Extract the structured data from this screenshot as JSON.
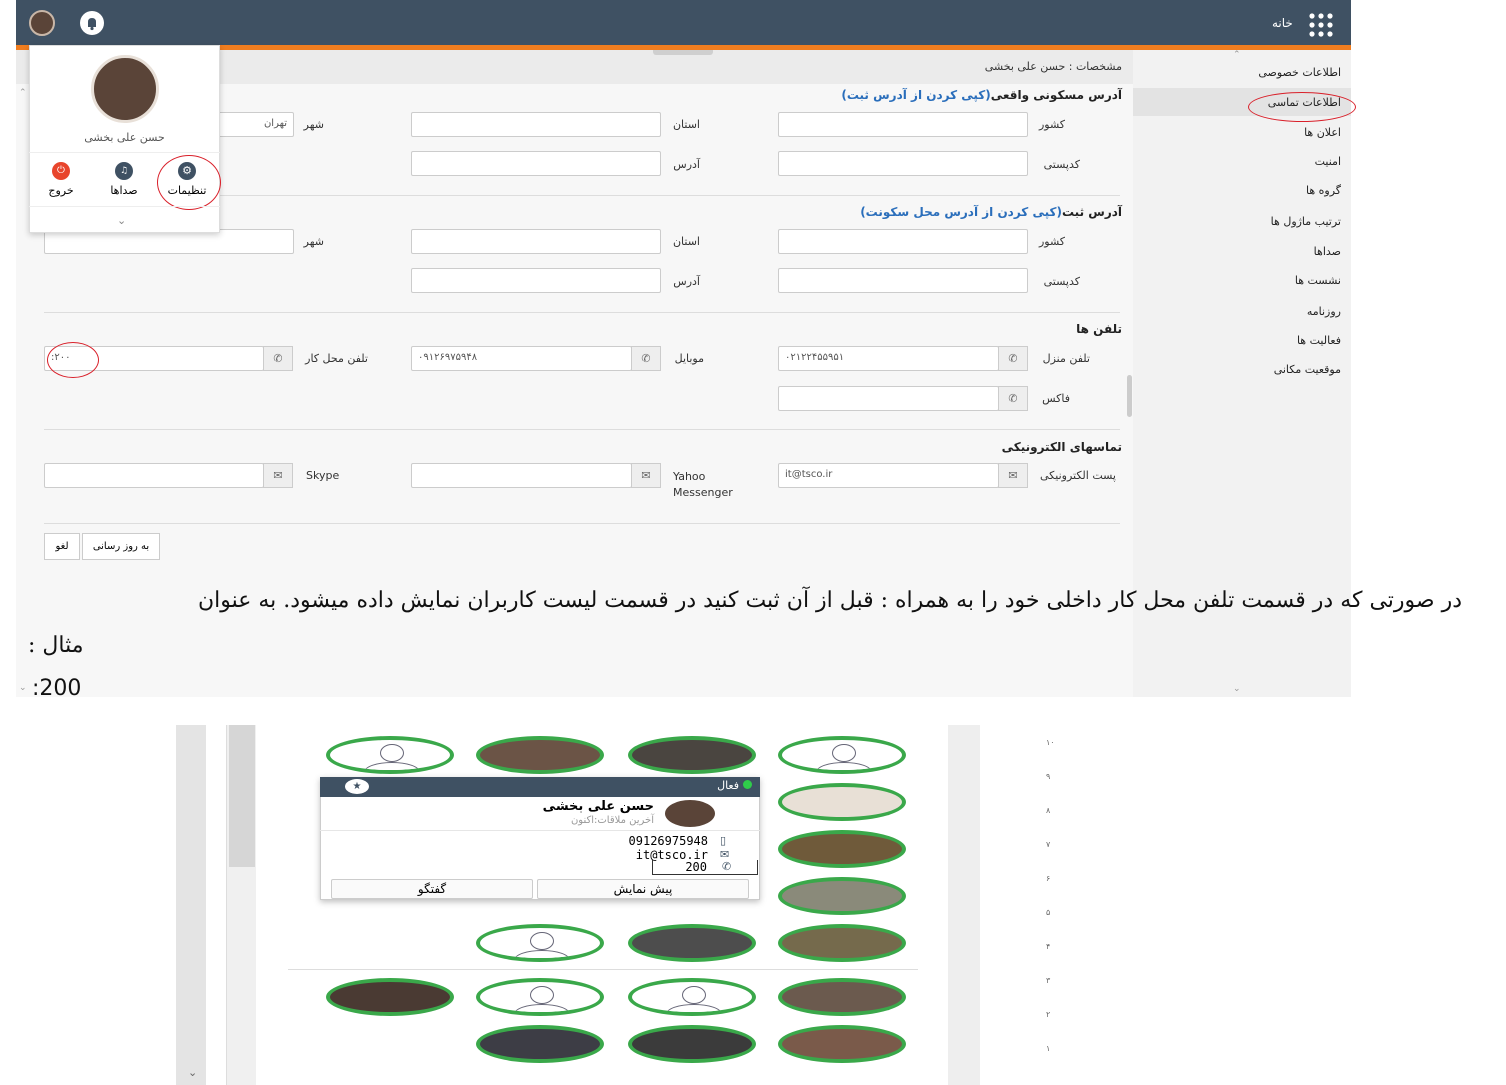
{
  "header": {
    "home_label": "خانه"
  },
  "profile_popup": {
    "name": "حسن علی بخشی",
    "settings_label": "تنظیمات",
    "sounds_label": "صداها",
    "logout_label": "خروج"
  },
  "sidebar": {
    "items": [
      "اطلاعات خصوصی",
      "اطلاعات تماسی",
      "اعلان ها",
      "امنیت",
      "گروه ها",
      "ترتیب ماژول ها",
      "صداها",
      "نشست ها",
      "روزنامه",
      "فعالیت ها",
      "موقعیت مکانی"
    ]
  },
  "page": {
    "title": "مشخصات : حسن علی بخشی"
  },
  "residential": {
    "heading": "آدرس مسکونی واقعی",
    "copy_link": "(کپی کردن از آدرس ثبت)",
    "country_label": "کشور",
    "province_label": "استان",
    "city_label": "شهر",
    "city_value": "تهران",
    "postal_label": "کدپستی",
    "address_label": "آدرس"
  },
  "registered": {
    "heading": "آدرس ثبت",
    "copy_link": "(کپی کردن از آدرس محل سکونت)",
    "country_label": "کشور",
    "province_label": "استان",
    "city_label": "شهر",
    "postal_label": "کدپستی",
    "address_label": "آدرس"
  },
  "phones": {
    "heading": "تلفن ها",
    "home_label": "تلفن منزل",
    "home_value": "۰۲۱۲۲۴۵۵۹۵۱",
    "mobile_label": "موبایل",
    "mobile_value": "۰۹۱۲۶۹۷۵۹۴۸",
    "work_label": "تلفن محل کار",
    "work_value": ":۲۰۰",
    "fax_label": "فاکس"
  },
  "electronic": {
    "heading": "تماسهای الکترونیکی",
    "email_label": "پست الکترونیکی",
    "email_value": "it@tsco.ir",
    "yahoo_label": "Yahoo Messenger",
    "skype_label": "Skype"
  },
  "buttons": {
    "update": "به روز رسانی",
    "cancel": "لغو"
  },
  "caption": {
    "line1": "در صورتی که در قسمت تلفن محل کار داخلی خود را به همراه : قبل از آن ثبت کنید در قسمت لیست کاربران نمایش داده میشود. به عنوان",
    "line2": "مثال :",
    "line3": ":200"
  },
  "user_card": {
    "status": "فعال",
    "name": "حسن علی بخشی",
    "last_seen": "آخرین ملاقات:اکنون",
    "mobile": "09126975948",
    "email": "it@tsco.ir",
    "extension": "200",
    "preview_button": "پیش نمایش",
    "chat_button": "گفتگو"
  },
  "scale_ticks": [
    "۱۰",
    "۹",
    "۸",
    "۷",
    "۶",
    "۵",
    "۴",
    "۳",
    "۲",
    "۱"
  ],
  "colors": {
    "topbar": "#3f5163",
    "accent": "#f07d1f",
    "ring": "#3aa84a",
    "annotation": "#d9202a"
  }
}
